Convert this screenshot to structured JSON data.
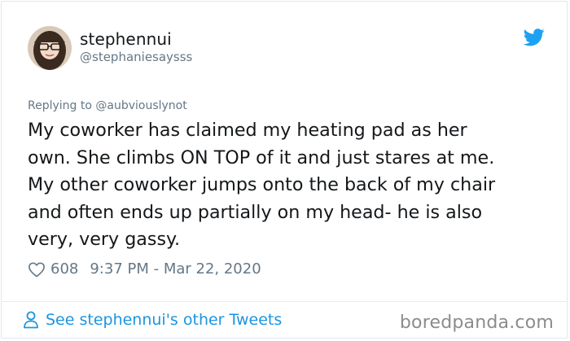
{
  "tweet": {
    "author": {
      "name": "stephennui",
      "handle": "@stephaniesaysss"
    },
    "replying_to": "Replying to @aubviouslynot",
    "text": "My coworker has claimed my heating pad as her\nown. She climbs ON TOP of it and just stares at me.\nMy other coworker jumps onto the back of my chair\nand often ends up partially on my head- he is also\nvery, very gassy.",
    "likes": "608",
    "timestamp": "9:37 PM - Mar 22, 2020"
  },
  "footer": {
    "link_label": "See stephennui's other Tweets",
    "watermark": "boredpanda.com"
  },
  "colors": {
    "twitter_blue": "#1da1f2",
    "link_blue": "#1b95e0",
    "muted_gray": "#657786"
  },
  "icons": [
    "twitter-bird-icon",
    "heart-icon",
    "person-icon"
  ]
}
